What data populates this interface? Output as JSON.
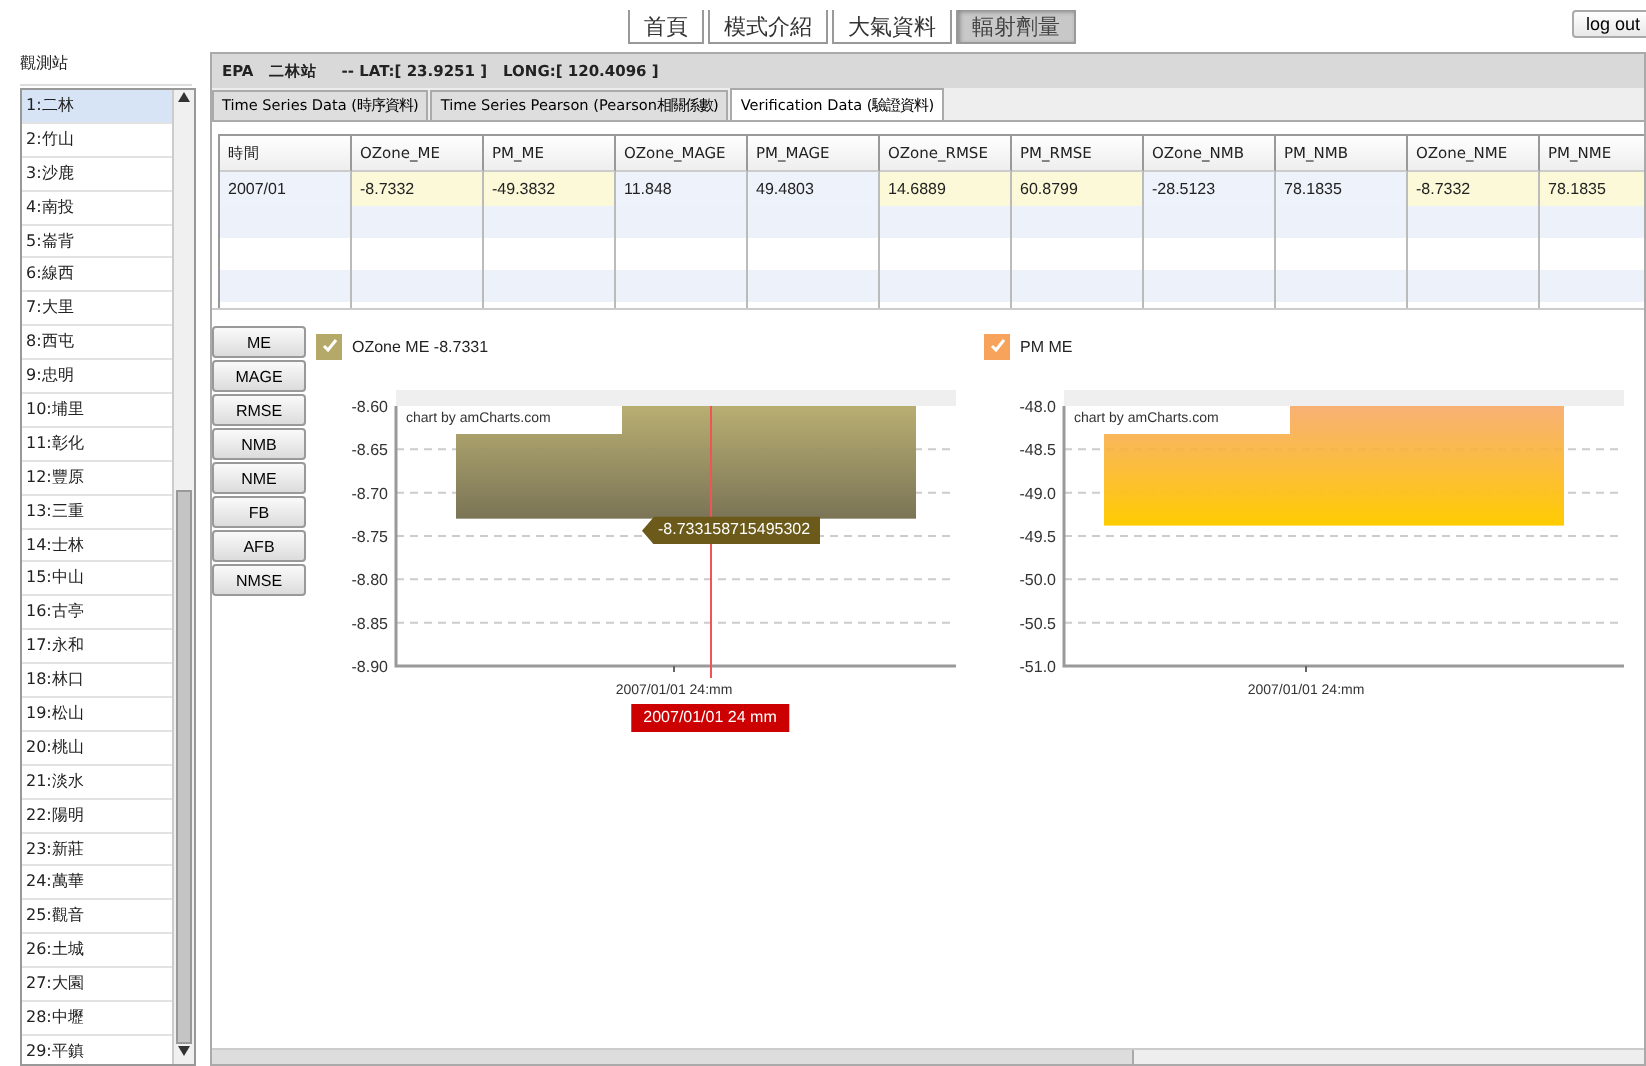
{
  "nav": {
    "items": [
      {
        "label": "首頁",
        "selected": false
      },
      {
        "label": "模式介紹",
        "selected": false
      },
      {
        "label": "大氣資料",
        "selected": false
      },
      {
        "label": "輻射劑量",
        "selected": true
      }
    ],
    "logout": "log out"
  },
  "sidebar": {
    "title": "觀測站",
    "items": [
      {
        "label": "1:二林",
        "selected": true
      },
      {
        "label": "2:竹山",
        "selected": false
      },
      {
        "label": "3:沙鹿",
        "selected": false
      },
      {
        "label": "4:南投",
        "selected": false
      },
      {
        "label": "5:崙背",
        "selected": false
      },
      {
        "label": "6:線西",
        "selected": false
      },
      {
        "label": "7:大里",
        "selected": false
      },
      {
        "label": "8:西屯",
        "selected": false
      },
      {
        "label": "9:忠明",
        "selected": false
      },
      {
        "label": "10:埔里",
        "selected": false
      },
      {
        "label": "11:彰化",
        "selected": false
      },
      {
        "label": "12:豐原",
        "selected": false
      },
      {
        "label": "13:三重",
        "selected": false
      },
      {
        "label": "14:士林",
        "selected": false
      },
      {
        "label": "15:中山",
        "selected": false
      },
      {
        "label": "16:古亭",
        "selected": false
      },
      {
        "label": "17:永和",
        "selected": false
      },
      {
        "label": "18:林口",
        "selected": false
      },
      {
        "label": "19:松山",
        "selected": false
      },
      {
        "label": "20:桃山",
        "selected": false
      },
      {
        "label": "21:淡水",
        "selected": false
      },
      {
        "label": "22:陽明",
        "selected": false
      },
      {
        "label": "23:新莊",
        "selected": false
      },
      {
        "label": "24:萬華",
        "selected": false
      },
      {
        "label": "25:觀音",
        "selected": false
      },
      {
        "label": "26:土城",
        "selected": false
      },
      {
        "label": "27:大園",
        "selected": false
      },
      {
        "label": "28:中壢",
        "selected": false
      },
      {
        "label": "29:平鎮",
        "selected": false
      }
    ]
  },
  "station_bar": {
    "station": "EPA　二林站",
    "coords": "-- LAT:[ 23.9251 ]　LONG:[ 120.4096 ]"
  },
  "tabs": [
    {
      "label": "Time Series Data (時序資料)",
      "selected": false
    },
    {
      "label": "Time Series Pearson (Pearson相關係數)",
      "selected": false
    },
    {
      "label": "Verification Data (驗證資料)",
      "selected": true
    }
  ],
  "table": {
    "columns": [
      "時間",
      "OZone_ME",
      "PM_ME",
      "OZone_MAGE",
      "PM_MAGE",
      "OZone_RMSE",
      "PM_RMSE",
      "OZone_NMB",
      "PM_NMB",
      "OZone_NME",
      "PM_NME"
    ],
    "rows": [
      [
        "2007/01",
        "-8.7332",
        "-49.3832",
        "11.848",
        "49.4803",
        "14.6889",
        "60.8799",
        "-28.5123",
        "78.1835",
        "-8.7332",
        "78.1835"
      ]
    ]
  },
  "metric_buttons": [
    "ME",
    "MAGE",
    "RMSE",
    "NMB",
    "NME",
    "FB",
    "AFB",
    "NMSE"
  ],
  "charts": [
    {
      "legend_value": "-8.7331",
      "checked": true,
      "credit": "chart by amCharts.com",
      "tooltip": "-8.733158715495302",
      "cursor_label": "2007/01/01 24 mm",
      "chart_data": {
        "type": "bar",
        "grid": true,
        "categories": [
          "2007/01/01 24:mm"
        ],
        "series": [
          {
            "name": "OZone ME",
            "color": "#b5a96a",
            "values": [
              -8.73
            ]
          }
        ],
        "ylim": [
          -8.9,
          -8.6
        ],
        "yticks": [
          {
            "value": -8.6,
            "label": "-8.60"
          },
          {
            "value": -8.65,
            "label": "-8.65"
          },
          {
            "value": -8.7,
            "label": "-8.70"
          },
          {
            "value": -8.75,
            "label": "-8.75"
          },
          {
            "value": -8.8,
            "label": "-8.80"
          },
          {
            "value": -8.85,
            "label": "-8.85"
          },
          {
            "value": -8.9,
            "label": "-8.90"
          }
        ]
      }
    },
    {
      "checked": true,
      "credit": "chart by amCharts.com",
      "chart_data": {
        "type": "bar",
        "grid": true,
        "categories": [
          "2007/01/01 24:mm"
        ],
        "series": [
          {
            "name": "PM ME",
            "color": "#f7a35c",
            "values": [
              -49.38
            ]
          }
        ],
        "ylim": [
          -51,
          -48
        ],
        "yticks": [
          {
            "value": -48,
            "label": "-48.0"
          },
          {
            "value": -48.5,
            "label": "-48.5"
          },
          {
            "value": -49,
            "label": "-49.0"
          },
          {
            "value": -49.5,
            "label": "-49.5"
          },
          {
            "value": -50,
            "label": "-50.0"
          },
          {
            "value": -50.5,
            "label": "-50.5"
          },
          {
            "value": -51,
            "label": "-51.0"
          }
        ]
      }
    }
  ]
}
